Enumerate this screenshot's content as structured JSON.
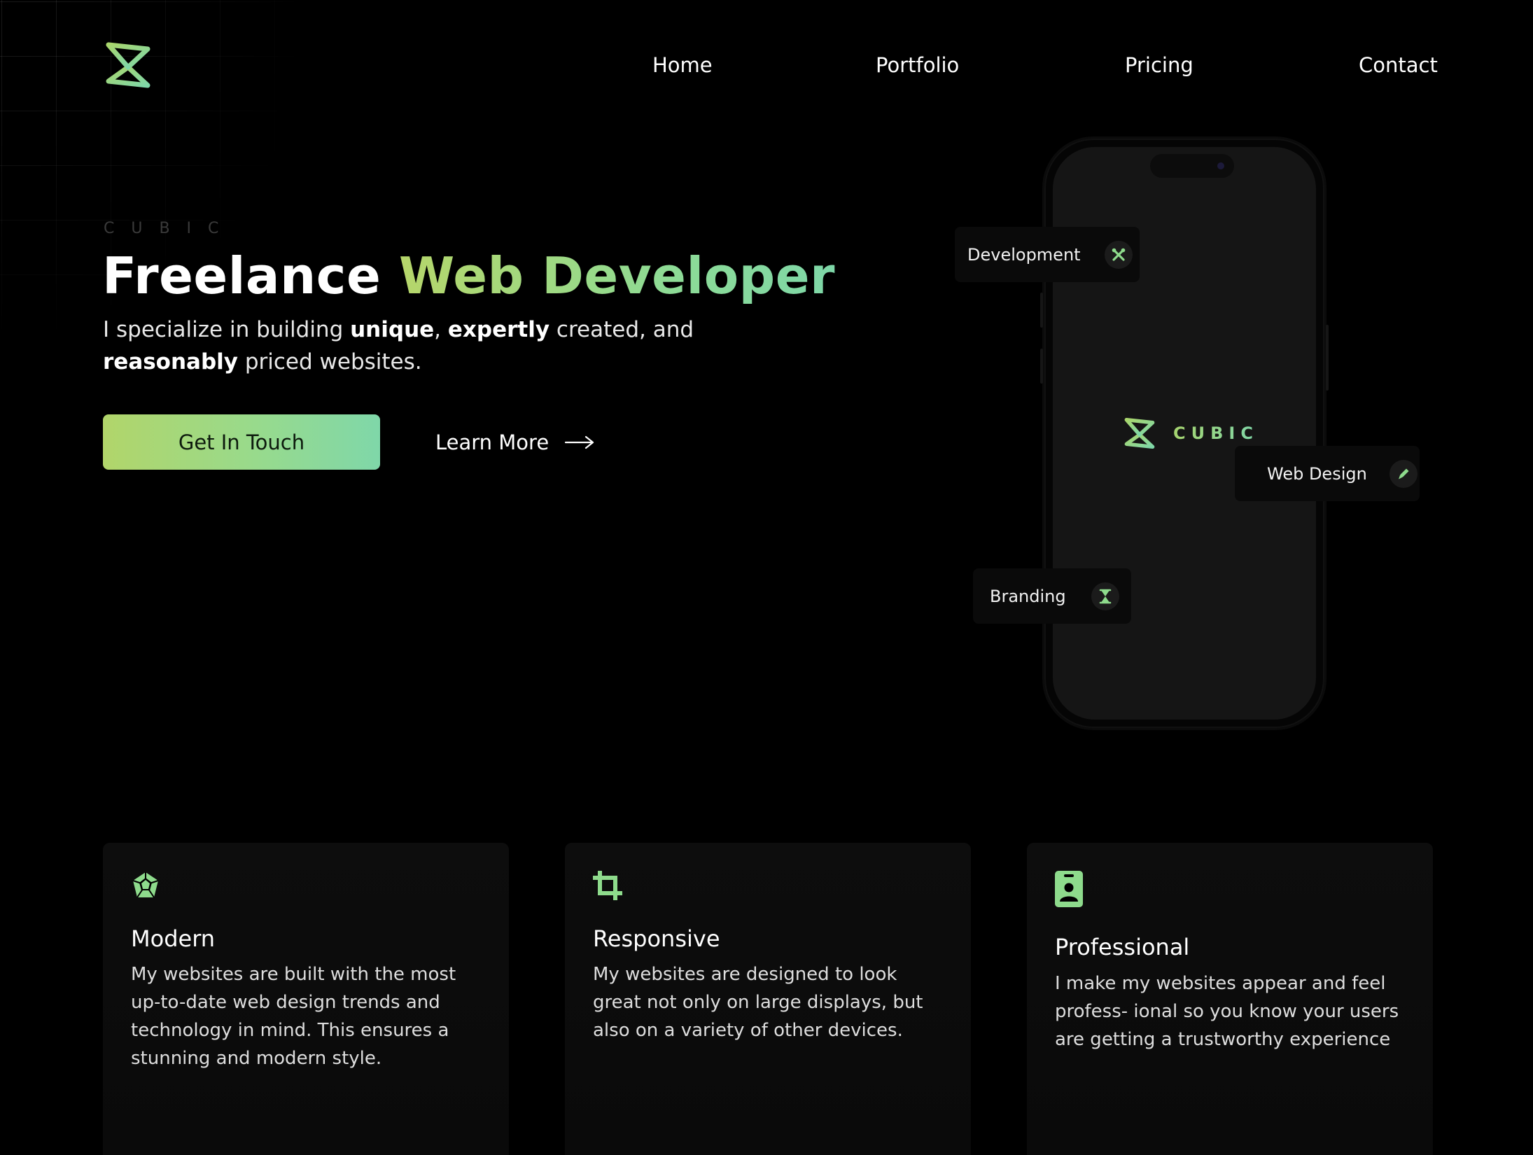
{
  "nav": {
    "home": "Home",
    "portfolio": "Portfolio",
    "pricing": "Pricing",
    "contact": "Contact"
  },
  "hero": {
    "eyebrow": "CUBIC",
    "title_plain": "Freelance ",
    "title_accent": "Web Developer",
    "sub_1": "I specialize in building ",
    "sub_b1": "unique",
    "sub_2": ", ",
    "sub_b2": "expertly",
    "sub_3": " created, and ",
    "sub_b3": "reasonably",
    "sub_4": " priced websites.",
    "cta_primary": "Get In Touch",
    "cta_secondary": "Learn More"
  },
  "phone": {
    "wordmark": "CUBIC",
    "tags": {
      "development": "Development",
      "web_design": "Web Design",
      "branding": "Branding"
    }
  },
  "features": [
    {
      "icon": "dodecahedron-icon",
      "title": "Modern",
      "text": "My websites are built with the most up-to-date web design trends and technology in mind. This ensures a stunning and modern style."
    },
    {
      "icon": "crop-icon",
      "title": "Responsive",
      "text": "My websites are designed to look great not only on large displays, but also on a variety of other devices."
    },
    {
      "icon": "id-badge-icon",
      "title": "Professional",
      "text": "I make my websites appear and feel profess- ional so you know your users are getting a trustworthy experience"
    }
  ],
  "colors": {
    "background": "#000000",
    "accent_start": "#b1d56a",
    "accent_end": "#7fd7a9",
    "card": "#0c0c0c"
  }
}
